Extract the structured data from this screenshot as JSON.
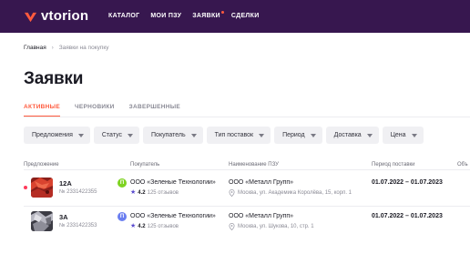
{
  "header": {
    "logo_text": "vtorion",
    "brand_color": "#ff5a3d",
    "bg_color": "#37174f",
    "nav": [
      {
        "label": "КАТАЛОГ"
      },
      {
        "label": "МОИ ПЗУ"
      },
      {
        "label": "ЗАЯВКИ",
        "has_dot": true
      },
      {
        "label": "СДЕЛКИ"
      }
    ]
  },
  "breadcrumb": {
    "home": "Главная",
    "separator": "›",
    "current": "Заявки на покупку"
  },
  "page": {
    "title": "Заявки"
  },
  "tabs": [
    {
      "label": "АКТИВНЫЕ",
      "active": true
    },
    {
      "label": "ЧЕРНОВИКИ",
      "active": false
    },
    {
      "label": "ЗАВЕРШЕННЫЕ",
      "active": false
    }
  ],
  "filters": [
    "Предложения",
    "Статус",
    "Покупатель",
    "Тип поставок",
    "Период",
    "Доставка",
    "Цена"
  ],
  "table": {
    "columns": [
      "Предложение",
      "Покупатель",
      "Наименование ПЗУ",
      "Период поставки",
      "Объ"
    ],
    "rows": [
      {
        "unread": true,
        "item_name": "12А",
        "item_number": "№ 2331422355",
        "buyer_initial": "П",
        "buyer_avatar_color": "#7ed321",
        "buyer_name": "ООО «Зеленые Технологии»",
        "rating_score": "4.2",
        "rating_reviews": "125 отзывов",
        "seller_name": "ООО «Металл Групп»",
        "seller_address": "Москва, ул. Академика Королёва, 15, корп. 1",
        "period": "01.07.2022 – 01.07.2023"
      },
      {
        "unread": false,
        "item_name": "3А",
        "item_number": "№ 2331422353",
        "buyer_initial": "П",
        "buyer_avatar_color": "#6a7ef0",
        "buyer_name": "ООО «Зеленые Технологии»",
        "rating_score": "4.2",
        "rating_reviews": "125 отзывов",
        "seller_name": "ООО «Металл Групп»",
        "seller_address": "Москва, ул. Шукова, 10, стр. 1",
        "period": "01.07.2022 – 01.07.2023"
      }
    ]
  }
}
